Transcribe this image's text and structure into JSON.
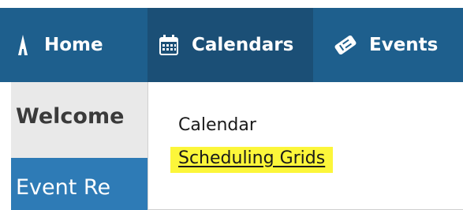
{
  "nav": {
    "home_label": "Home",
    "calendars_label": "Calendars",
    "events_label": "Events"
  },
  "page": {
    "welcome_text": "Welcome",
    "event_text": "Event Re"
  },
  "dropdown": {
    "items": [
      {
        "label": "Calendar"
      },
      {
        "label": "Scheduling Grids",
        "highlighted": true
      }
    ]
  },
  "colors": {
    "nav_bg": "#1e5f8d",
    "nav_active_bg": "#1b4f76",
    "highlight": "#fcf63a",
    "event_bar": "#2e7bb6"
  },
  "icons": {
    "home": "home-icon",
    "calendars": "calendar-icon",
    "events": "events-icon"
  }
}
